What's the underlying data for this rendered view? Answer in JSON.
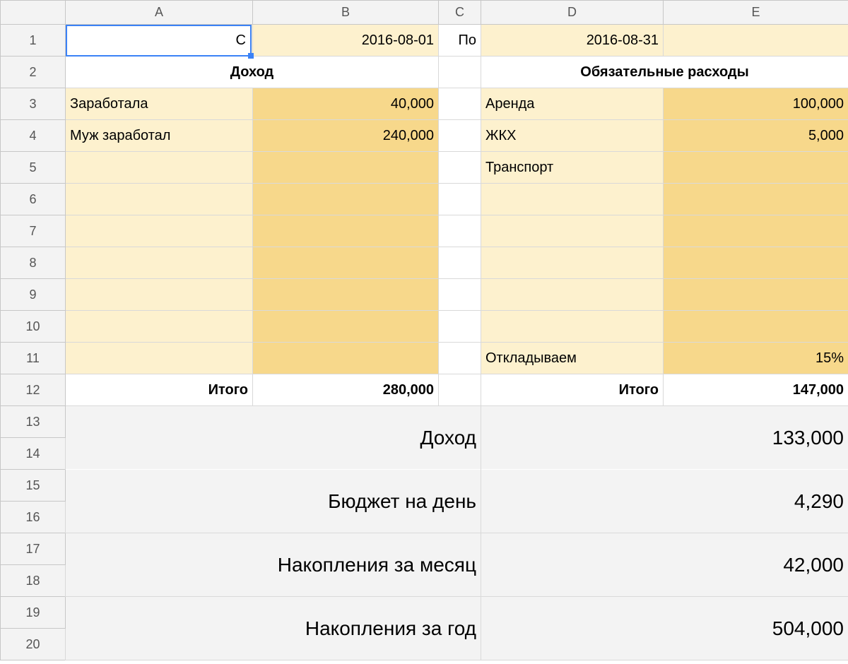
{
  "columns": [
    "A",
    "B",
    "C",
    "D",
    "E"
  ],
  "row_count": 20,
  "period": {
    "from_label": "С",
    "from_date": "2016-08-01",
    "to_label": "По",
    "to_date": "2016-08-31"
  },
  "income": {
    "header": "Доход",
    "rows": [
      {
        "label": "Заработала",
        "value": "40,000"
      },
      {
        "label": "Муж заработал",
        "value": "240,000"
      },
      {
        "label": "",
        "value": ""
      },
      {
        "label": "",
        "value": ""
      },
      {
        "label": "",
        "value": ""
      },
      {
        "label": "",
        "value": ""
      },
      {
        "label": "",
        "value": ""
      },
      {
        "label": "",
        "value": ""
      },
      {
        "label": "",
        "value": ""
      }
    ],
    "total_label": "Итого",
    "total_value": "280,000"
  },
  "expenses": {
    "header": "Обязательные расходы",
    "rows": [
      {
        "label": "Аренда",
        "value": "100,000"
      },
      {
        "label": "ЖКХ",
        "value": "5,000"
      },
      {
        "label": "Транспорт",
        "value": ""
      },
      {
        "label": "",
        "value": ""
      },
      {
        "label": "",
        "value": ""
      },
      {
        "label": "",
        "value": ""
      },
      {
        "label": "",
        "value": ""
      },
      {
        "label": "",
        "value": ""
      },
      {
        "label": "Откладываем",
        "value": "15%"
      }
    ],
    "total_label": "Итого",
    "total_value": "147,000"
  },
  "summary": [
    {
      "label": "Доход",
      "value": "133,000"
    },
    {
      "label": "Бюджет на день",
      "value": "4,290"
    },
    {
      "label": "Накопления за месяц",
      "value": "42,000"
    },
    {
      "label": "Накопления за год",
      "value": "504,000"
    }
  ],
  "selected_cell_text": "С"
}
